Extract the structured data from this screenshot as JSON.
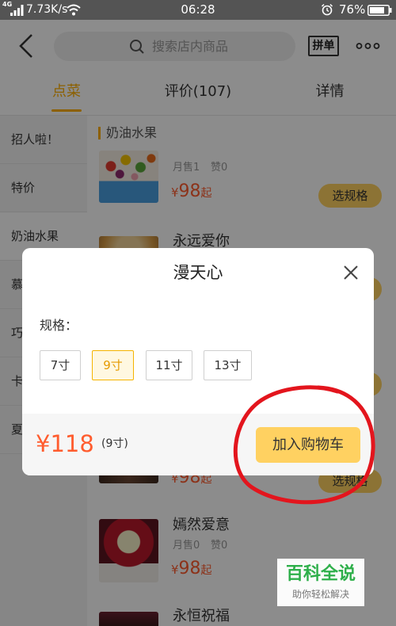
{
  "status_bar": {
    "network": "4G",
    "speed": "7.73K/s",
    "time": "06:28",
    "battery": "76%"
  },
  "header": {
    "search_placeholder": "搜索店内商品",
    "group_order_label": "拼单"
  },
  "tabs": [
    {
      "label": "点菜",
      "active": true
    },
    {
      "label": "评价(107)",
      "active": false
    },
    {
      "label": "详情",
      "active": false
    }
  ],
  "sidebar": {
    "items": [
      {
        "label": "招人啦！",
        "selected": false
      },
      {
        "label": "特价",
        "selected": false
      },
      {
        "label": "奶油水果",
        "selected": true
      },
      {
        "label": "慕",
        "selected": false
      },
      {
        "label": "巧",
        "selected": false
      },
      {
        "label": "卡",
        "selected": false
      },
      {
        "label": "夏",
        "selected": false
      }
    ]
  },
  "section_title": "奶油水果",
  "products": [
    {
      "sales": "月售1",
      "likes": "赞0",
      "currency": "¥",
      "price": "98",
      "price_suffix": "起",
      "button_label": "选规格"
    },
    {
      "title": "永远爱你"
    },
    {
      "currency": "¥",
      "price": "98",
      "price_suffix": "起",
      "button_label": "选规格"
    },
    {
      "title": "嫣然爱意",
      "sales": "月售0",
      "likes": "赞0",
      "currency": "¥",
      "price": "98",
      "price_suffix": "起"
    },
    {
      "title": "永恒祝福"
    }
  ],
  "modal": {
    "title": "漫天心",
    "spec_label": "规格：",
    "options": [
      {
        "label": "7寸",
        "selected": false
      },
      {
        "label": "9寸",
        "selected": true
      },
      {
        "label": "11寸",
        "selected": false
      },
      {
        "label": "13寸",
        "selected": false
      }
    ],
    "price": "¥118",
    "price_note": "(9寸)",
    "add_to_cart_label": "加入购物车"
  },
  "watermark": {
    "brand": "百科全说",
    "slogan": "助你轻松解决"
  },
  "colors": {
    "accent": "#ffd161",
    "tab_active": "#ffb000",
    "price": "#ff5c2e",
    "annotation": "#e3151d",
    "watermark_green": "#2eaf4a",
    "status_bar": "#545454"
  },
  "icons": [
    "signal-icon",
    "wifi-icon",
    "alarm-icon",
    "battery-icon",
    "back-icon",
    "search-icon",
    "more-icon",
    "close-icon"
  ]
}
